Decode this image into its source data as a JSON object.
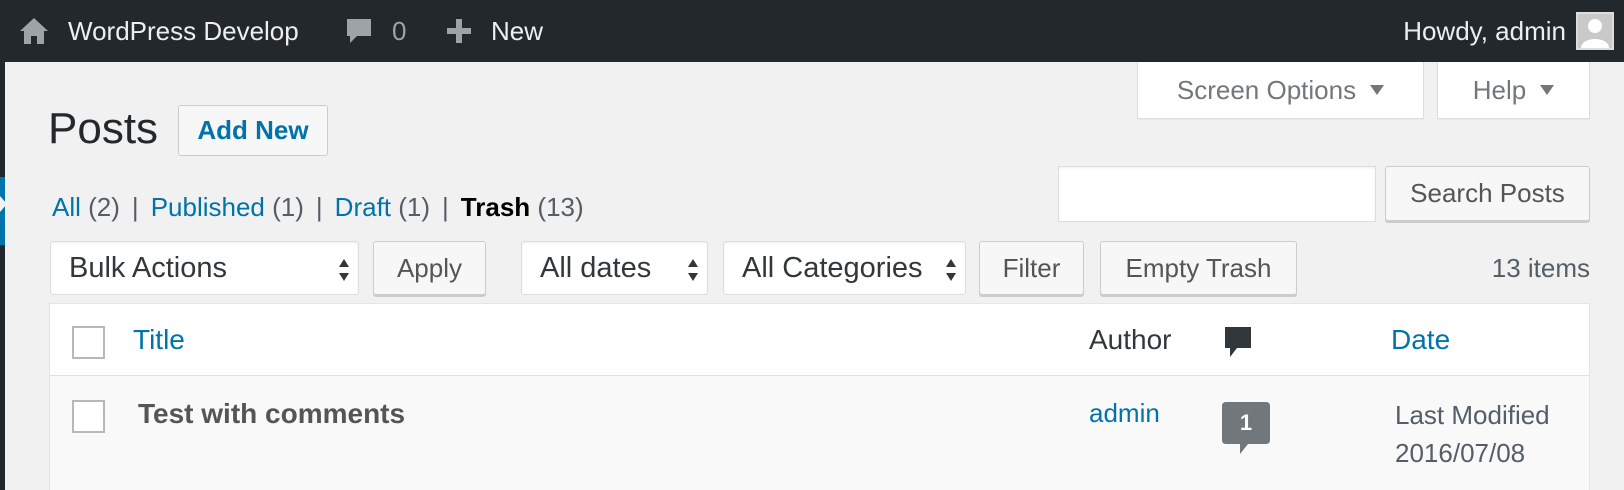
{
  "adminbar": {
    "site_name": "WordPress Develop",
    "comment_count": "0",
    "new_label": "New",
    "howdy": "Howdy, admin"
  },
  "screen_meta": {
    "screen_options": "Screen Options",
    "help": "Help"
  },
  "page": {
    "title": "Posts",
    "add_new": "Add New"
  },
  "views": [
    {
      "label": "All",
      "count": "(2)"
    },
    {
      "label": "Published",
      "count": "(1)"
    },
    {
      "label": "Draft",
      "count": "(1)"
    },
    {
      "label": "Trash",
      "count": "(13)"
    }
  ],
  "search": {
    "value": "",
    "button": "Search Posts"
  },
  "tablenav": {
    "bulk_actions": "Bulk Actions",
    "apply": "Apply",
    "dates": "All dates",
    "categories": "All Categories",
    "filter": "Filter",
    "empty_trash": "Empty Trash",
    "items_count": "13 items"
  },
  "table": {
    "columns": {
      "title": "Title",
      "author": "Author",
      "date": "Date"
    },
    "rows": [
      {
        "title": "Test with comments",
        "author": "admin",
        "comments": "1",
        "date_label": "Last Modified",
        "date": "2016/07/08"
      }
    ]
  },
  "colors": {
    "adminbar": "#23282d",
    "link": "#0073aa",
    "background": "#f1f1f1"
  }
}
